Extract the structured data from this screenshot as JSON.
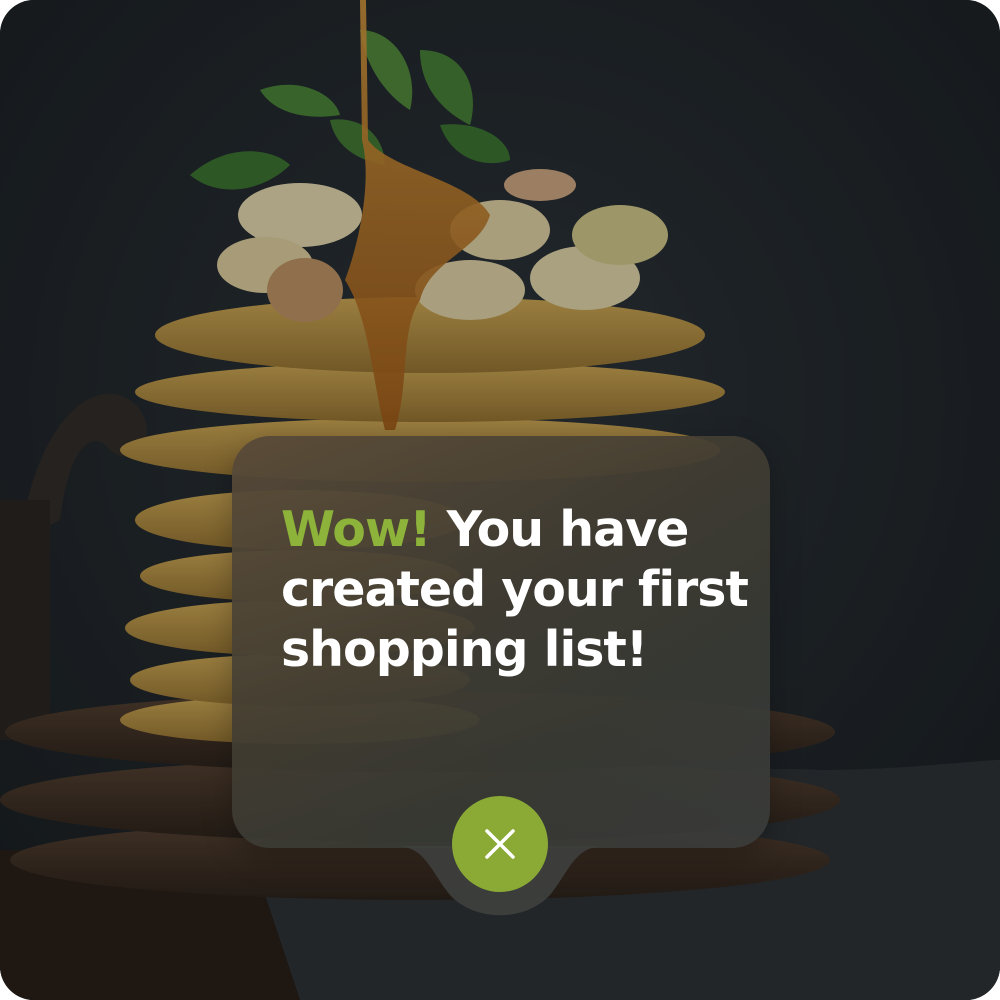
{
  "dialog": {
    "accent_text": "Wow!",
    "message_text": "You have created your first shopping list!",
    "close_icon": "close-icon"
  },
  "colors": {
    "accent": "#8db33a",
    "close_button": "#8aaa35",
    "text": "#ffffff",
    "background": "#23282d"
  }
}
